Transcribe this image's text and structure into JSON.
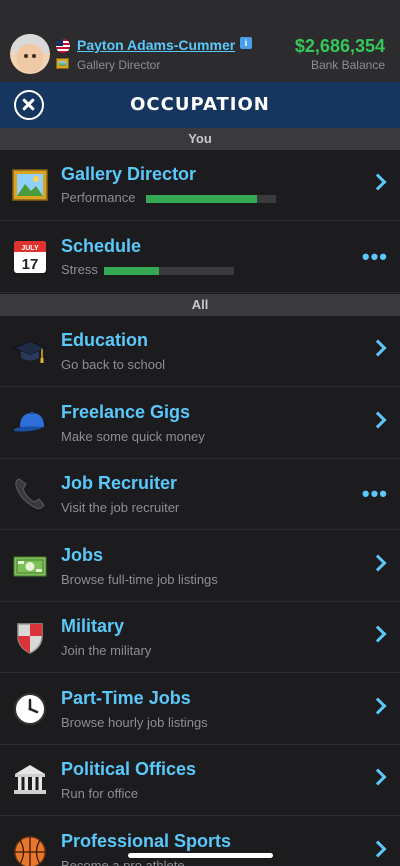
{
  "header": {
    "name": "Payton Adams-Cummer",
    "job": "Gallery Director",
    "balance": "$2,686,354",
    "balance_label": "Bank Balance",
    "info_badge": "i"
  },
  "titlebar": {
    "title": "OCCUPATION"
  },
  "sections": {
    "you": "You",
    "all": "All"
  },
  "you_rows": [
    {
      "label": "Gallery Director",
      "sub": "Performance",
      "level": 0.85,
      "icon": "framed-picture-icon"
    },
    {
      "label": "Schedule",
      "sub": "Stress",
      "level": 0.42,
      "icon": "calendar-icon",
      "cal_month": "JULY",
      "cal_day": "17"
    }
  ],
  "all_rows": [
    {
      "label": "Education",
      "sub": "Go back to school",
      "icon": "graduation-cap-icon"
    },
    {
      "label": "Freelance Gigs",
      "sub": "Make some quick money",
      "icon": "baseball-cap-icon"
    },
    {
      "label": "Job Recruiter",
      "sub": "Visit the job recruiter",
      "icon": "telephone-icon"
    },
    {
      "label": "Jobs",
      "sub": "Browse full-time job listings",
      "icon": "money-icon"
    },
    {
      "label": "Military",
      "sub": "Join the military",
      "icon": "shield-icon"
    },
    {
      "label": "Part-Time Jobs",
      "sub": "Browse hourly job listings",
      "icon": "clock-icon"
    },
    {
      "label": "Political Offices",
      "sub": "Run for office",
      "icon": "government-building-icon"
    },
    {
      "label": "Professional Sports",
      "sub": "Become a pro athlete",
      "icon": "basketball-icon"
    }
  ],
  "glyphs": {
    "more": "•••"
  },
  "colors": {
    "accent": "#5ac8fa",
    "balance": "#34c759",
    "bar": "#34a853",
    "titlebar": "#17365f"
  }
}
